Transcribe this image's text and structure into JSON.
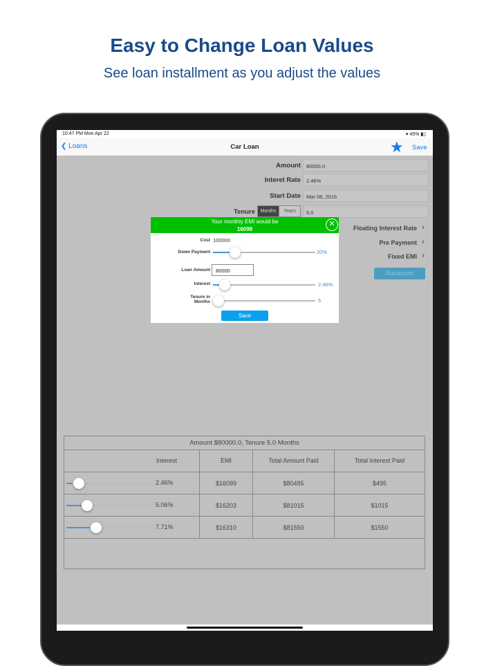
{
  "promo": {
    "title": "Easy to Change Loan Values",
    "subtitle": "See loan installment as you adjust the values"
  },
  "status": {
    "time": "10:47 PM  Mon Apr 22",
    "battery": "45%"
  },
  "nav": {
    "back": "Loans",
    "title": "Car Loan",
    "save": "Save"
  },
  "form": {
    "amount_label": "Amount",
    "amount": "80000.0",
    "rate_label": "Interet Rate",
    "rate": "2.46%",
    "date_label": "Start Date",
    "date": "Mar 08, 2016",
    "tenure_label": "Tenure",
    "seg_months": "Months",
    "seg_years": "Years",
    "tenure": "5.0"
  },
  "links": {
    "floating": "Floating Interest Rate",
    "prepayment": "Pre Payment",
    "fixed": "Fixed EMI",
    "advanced": "Advanced"
  },
  "popup": {
    "line1": "Your  monthly EMI would be",
    "emi": "16099",
    "cost_label": "Cost",
    "cost": "100000",
    "down_label": "Down Payment",
    "down_value": "20%",
    "down_fraction": 0.2,
    "loan_label": "Loan Amount",
    "loan_value": "80000",
    "interest_label": "Interest",
    "interest_value": "2.46%",
    "tenure_label_1": "Tenure in",
    "tenure_label_2": "Months",
    "tenure_value": "5",
    "save": "Save"
  },
  "table": {
    "title": "Amount $80000.0, Tenure 5.0 Months",
    "headers": [
      "Interest",
      "EMI",
      "Total Amount Paid",
      "Total Interest Paid"
    ],
    "rows": [
      [
        "2.46%",
        "$16099",
        "$80495",
        "$495"
      ],
      [
        "5.06%",
        "$16203",
        "$81015",
        "$1015"
      ],
      [
        "7.71%",
        "$16310",
        "$81550",
        "$1550"
      ]
    ]
  }
}
